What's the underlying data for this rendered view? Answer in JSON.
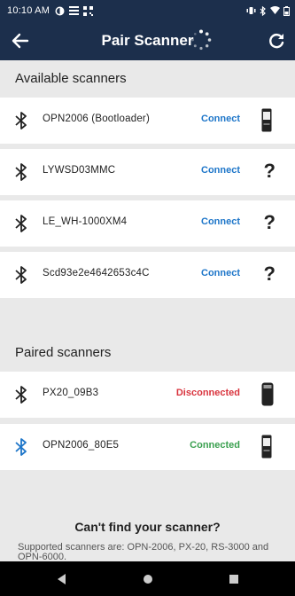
{
  "status": {
    "time": "10:10 AM"
  },
  "header": {
    "title": "Pair Scanner"
  },
  "available": {
    "title": "Available scanners",
    "items": [
      {
        "name": "OPN2006 (Bootloader)",
        "action": "Connect",
        "device": "scanner"
      },
      {
        "name": "LYWSD03MMC",
        "action": "Connect",
        "device": "unknown"
      },
      {
        "name": "LE_WH-1000XM4",
        "action": "Connect",
        "device": "unknown"
      },
      {
        "name": "Scd93e2e4642653c4C",
        "action": "Connect",
        "device": "unknown"
      }
    ]
  },
  "paired": {
    "title": "Paired scanners",
    "items": [
      {
        "name": "PX20_09B3",
        "action": "Disconnected"
      },
      {
        "name": "OPN2006_80E5",
        "action": "Connected"
      }
    ]
  },
  "help": {
    "title": "Can't find your scanner?",
    "text": "Supported scanners are: OPN-2006, PX-20, RS-3000 and OPN-6000."
  },
  "unknown_symbol": "?",
  "colors": {
    "primary": "#1c2f4c",
    "connect": "#1e76c9",
    "disconnected": "#d9343e",
    "connected": "#3aa04f"
  }
}
